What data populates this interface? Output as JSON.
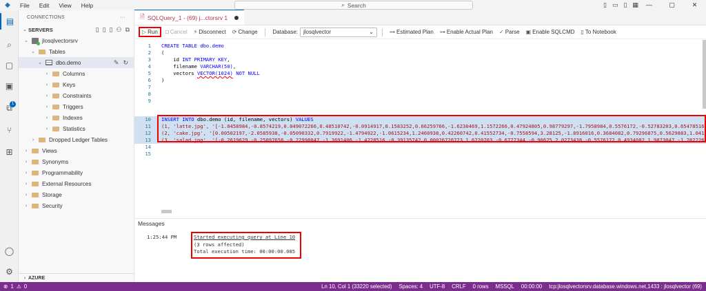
{
  "titlebar": {
    "menu": [
      "File",
      "Edit",
      "View",
      "Help"
    ],
    "search_label": "Search"
  },
  "activity_badge": "1",
  "sidebar": {
    "header": "CONNECTIONS",
    "servers_label": "SERVERS",
    "server": "jlosqlvectorsrv",
    "tables": "Tables",
    "table": "dbo.demo",
    "table_children": [
      "Columns",
      "Keys",
      "Constraints",
      "Triggers",
      "Indexes",
      "Statistics"
    ],
    "dropped": "Dropped Ledger Tables",
    "folders": [
      "Views",
      "Synonyms",
      "Programmability",
      "External Resources",
      "Storage",
      "Security"
    ],
    "azure": "AZURE"
  },
  "tab": {
    "title": "SQLQuery_1 - (69) j...ctorsrv 1"
  },
  "toolbar": {
    "run": "Run",
    "cancel": "Cancel",
    "disconnect": "Disconnect",
    "change": "Change",
    "database_label": "Database:",
    "database_value": "jlosqlvector",
    "estimated": "Estimated Plan",
    "actual": "Enable Actual Plan",
    "parse": "Parse",
    "sqlcmd": "Enable SQLCMD",
    "notebook": "To Notebook"
  },
  "code": {
    "line_numbers": [
      "1",
      "2",
      "3",
      "4",
      "5",
      "6",
      "7",
      "8",
      "9",
      "10",
      "11",
      "12",
      "13",
      "14",
      "15"
    ],
    "l1": "CREATE TABLE dbo.demo",
    "l2": "(",
    "l3a": "    id ",
    "l3b": "INT PRIMARY KEY",
    "l4a": "    filename ",
    "l4b": "VARCHAR(50)",
    "l5a": "    vectors ",
    "l5b": "VECTOR(1024)",
    "l5c": " NOT NULL",
    "l6": ")",
    "l10a": "INSERT INTO",
    "l10b": " dbo.demo (id, filename, vectors) ",
    "l10c": "VALUES",
    "l11": "(1, 'latte.jpg', '[-1.0458984,-0.8574219,0.049072266,0.48510742,-0.0914917,0.1583252,0.66259766,-1.6230469,1.1572266,0.47924805,0.98779297,-1.7958984,0.5576172,-0.52783203,0.65478516,",
    "l12": "(2, 'cake.jpg', '[0.00502197,-2.0585938,-0.05090332,0.7919922,-1.4794922,-1.0615234,1.2460938,0.42260742,0.41552734,-0.7558594,3.28125,-1.8916016,0.3684082,0.79296875,0.5629883,1.04199",
    "l13": "(3, 'salad.jpg', '[-0.2619629,-0.25097656,-0.22998047,-1.3691406,-1.4228516,-0.39135742,0.00026726723,1.6220703,-0.6777344,-0.90625,2.0273438,-0.5576172,0.4934082,1.9873047,-1.2822266,"
  },
  "messages": {
    "title": "Messages",
    "time": "1:25:44 PM",
    "started": "Started executing query at Line 10",
    "affected": "(3 rows affected)",
    "total": "Total execution time: 00:00:00.085"
  },
  "statusbar": {
    "errors": "1",
    "warnings": "0",
    "position": "Ln 10, Col 1 (33220 selected)",
    "spaces": "Spaces: 4",
    "encoding": "UTF-8",
    "eol": "CRLF",
    "rows": "0 rows",
    "lang": "MSSQL",
    "elapsed": "00:00:00",
    "connection": "tcp:jlosqlvectorsrv.database.windows.net,1433 : jlosqlvector (69)"
  },
  "colors": {
    "statusbar": "#7b2d8e",
    "accent": "#0067c0",
    "highlight_box": "#e00000"
  }
}
